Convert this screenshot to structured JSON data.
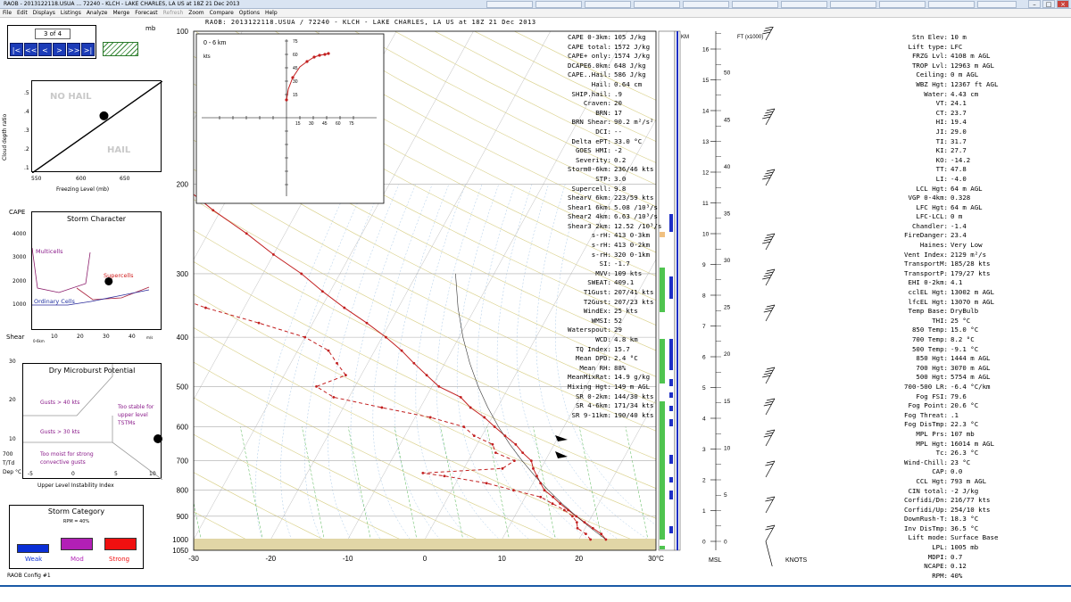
{
  "window": {
    "title": "RAOB - 2013122118.USUA ... 72240 - KLCH - LAKE CHARLES, LA US at 18Z 21 Dec 2013",
    "controls": [
      "–",
      "□",
      "×"
    ]
  },
  "menu": [
    {
      "label": "File",
      "enabled": true
    },
    {
      "label": "Edit",
      "enabled": true
    },
    {
      "label": "Displays",
      "enabled": true
    },
    {
      "label": "Listings",
      "enabled": true
    },
    {
      "label": "Analyze",
      "enabled": true
    },
    {
      "label": "Merge",
      "enabled": true
    },
    {
      "label": "Forecast",
      "enabled": true
    },
    {
      "label": "Refresh",
      "enabled": false
    },
    {
      "label": "Zoom",
      "enabled": true
    },
    {
      "label": "Compare",
      "enabled": true
    },
    {
      "label": "Options",
      "enabled": true
    },
    {
      "label": "Help",
      "enabled": true
    }
  ],
  "header": {
    "title": "RAOB:  2013122118.USUA / 72240 - KLCH - LAKE CHARLES, LA US at 18Z 21 Dec 2013"
  },
  "nav": {
    "count": "3 of 4",
    "unit": "mb",
    "buttons": [
      "|<",
      "<<",
      "<",
      ">",
      ">>",
      ">|"
    ]
  },
  "hail": {
    "no_hail": "NO HAIL",
    "hail": "HAIL",
    "ylabel": "Cloud depth ratio",
    "xlabel": "Freezing Level (mb)",
    "yticks": [
      ".5",
      ".4",
      ".3",
      ".2",
      ".1"
    ],
    "xticks": [
      "550",
      "600",
      "650"
    ],
    "point": {
      "freezing_level_mb": 615,
      "cloud_depth_ratio": 0.4
    }
  },
  "storm": {
    "title": "Storm Character",
    "ylabel": "CAPE",
    "yticks": [
      "4000",
      "3000",
      "2000",
      "1000"
    ],
    "xlabel": "Shear",
    "xsub": "0-6km",
    "xticks": [
      "10",
      "20",
      "30",
      "40"
    ],
    "xunit": "m/s",
    "multicells": "Multicells",
    "supercells": "Supercells",
    "ordinary": "Ordinary Cells",
    "point": {
      "shear_ms": 27,
      "cape": 1572
    }
  },
  "micro": {
    "title": "Dry Microburst Potential",
    "gusts40": "Gusts > 40 kts",
    "gusts30": "Gusts > 30 kts",
    "toostable": "Too stable for upper level TSTMs",
    "toomoist": "Too moist for strong convective gusts",
    "yticks": [
      "30",
      "20",
      "10"
    ],
    "xticks": [
      "-5",
      "0",
      "5",
      "10"
    ],
    "ylabel": "700 T/Td Dep °C",
    "xlabel": "Upper Level Instability Index"
  },
  "category": {
    "title": "Storm Category",
    "rpm": "RPM = 40%",
    "labels": [
      "Weak",
      "Mod",
      "Strong"
    ],
    "colors": [
      "#0a2fd6",
      "#b21fb6",
      "#f01010"
    ]
  },
  "config": "RAOB Config #1",
  "skewt": {
    "pressure_labels": [
      "100",
      "200",
      "300",
      "400",
      "500",
      "600",
      "700",
      "800",
      "900",
      "1000",
      "1050"
    ],
    "temp_labels": [
      "-30",
      "-20",
      "-10",
      "0",
      "10",
      "20",
      "30°C"
    ],
    "hodo": {
      "title": "0 - 6 km",
      "unit": "kts",
      "ticks": [
        "75",
        "60",
        "45",
        "30",
        "15"
      ],
      "xticks": [
        "15",
        "30",
        "45",
        "60",
        "75"
      ]
    },
    "km_label": "KM",
    "ft_label": "FT (x1000)",
    "msl_label": "MSL",
    "knots_label": "KNOTS",
    "km_ticks": [
      "16",
      "15",
      "14",
      "13",
      "12",
      "11",
      "10",
      "9",
      "8",
      "7",
      "6",
      "5",
      "4",
      "3",
      "2",
      "1",
      "0"
    ],
    "ft_ticks": [
      "50",
      "45",
      "40",
      "35",
      "30",
      "25",
      "20",
      "15",
      "10",
      "5",
      "0"
    ]
  },
  "mid_table": [
    {
      "label": "CAPE 0-3km:",
      "value": "105 J/kg"
    },
    {
      "label": "CAPE total:",
      "value": "1572 J/kg"
    },
    {
      "label": "CAPE+ only:",
      "value": "1574 J/kg"
    },
    {
      "label": "DCAPE6.0km:",
      "value": "648 J/kg"
    },
    {
      "label": "CAPE..Hail:",
      "value": "586 J/kg"
    },
    {
      "label": "Hail:",
      "value": "0.64 cm"
    },
    {
      "label": "SHIP.hail:",
      "value": ".9"
    },
    {
      "label": "Craven:",
      "value": "20"
    },
    {
      "label": "BRN:",
      "value": "17"
    },
    {
      "label": "BRN Shear:",
      "value": "90.2 m²/s²"
    },
    {
      "label": "DCI:",
      "value": "--"
    },
    {
      "label": "Delta ePT:",
      "value": "33.0 °C"
    },
    {
      "label": "GOES HMI:",
      "value": "-2"
    },
    {
      "label": "Severity:",
      "value": "0.2"
    },
    {
      "label": "Storm0-6km:",
      "value": "236/46 kts"
    },
    {
      "label": "STP:",
      "value": "3.0"
    },
    {
      "label": "Supercell:",
      "value": "9.8"
    },
    {
      "label": "ShearV 6km:",
      "value": "223/59 kts"
    },
    {
      "label": "Shear1 6km:",
      "value": "5.08 /10³/s"
    },
    {
      "label": "Shear2 4km:",
      "value": "6.63 /10³/s"
    },
    {
      "label": "Shear3 2km:",
      "value": "12.52 /10³/s"
    },
    {
      "label": "s-rH:",
      "value": "413  0-3km"
    },
    {
      "label": "s-rH:",
      "value": "413  0-2km"
    },
    {
      "label": "s-rH:",
      "value": "320  0-1km"
    },
    {
      "label": "SI:",
      "value": "-1.7"
    },
    {
      "label": "MVV:",
      "value": "109 kts"
    },
    {
      "label": "SWEAT:",
      "value": "409.1"
    },
    {
      "label": "T1Gust:",
      "value": "207/41 kts"
    },
    {
      "label": "T2Gust:",
      "value": "207/23 kts"
    },
    {
      "label": "WindEx:",
      "value": "25 kts"
    },
    {
      "label": "WMSI:",
      "value": "52"
    },
    {
      "label": "Waterspout:",
      "value": "29"
    },
    {
      "label": "WCD:",
      "value": "4.8 km"
    },
    {
      "label": "TQ Index:",
      "value": "15.7"
    },
    {
      "label": "Mean DPD:",
      "value": "2.4 °C"
    },
    {
      "label": "Mean RH:",
      "value": "88%"
    },
    {
      "label": "MeanMixRat:",
      "value": "14.9 g/kg"
    },
    {
      "label": "Mixing Hgt:",
      "value": "149 m AGL"
    },
    {
      "label": "SR 0-2km:",
      "value": "144/30 kts"
    },
    {
      "label": "SR 4-6km:",
      "value": "171/34 kts"
    },
    {
      "label": "SR 9-11km:",
      "value": "190/40 kts"
    }
  ],
  "right_table": [
    {
      "label": "Stn Elev:",
      "value": "10 m"
    },
    {
      "label": "Lift type:",
      "value": "LFC"
    },
    {
      "label": "FRZG Lvl:",
      "value": "4108 m AGL"
    },
    {
      "label": "TROP Lvl:",
      "value": "12963 m AGL"
    },
    {
      "label": "Ceiling:",
      "value": "0 m AGL"
    },
    {
      "label": "WBZ Hgt:",
      "value": "12367 ft AGL"
    },
    {
      "label": "Water:",
      "value": "4.43 cm"
    },
    {
      "label": "VT:",
      "value": "24.1"
    },
    {
      "label": "CT:",
      "value": "23.7"
    },
    {
      "label": "HI:",
      "value": "19.4"
    },
    {
      "label": "JI:",
      "value": "29.0"
    },
    {
      "label": "TI:",
      "value": "31.7"
    },
    {
      "label": "KI:",
      "value": "27.7"
    },
    {
      "label": "KO:",
      "value": "-14.2"
    },
    {
      "label": "TT:",
      "value": "47.8"
    },
    {
      "label": "LI:",
      "value": "-4.0"
    },
    {
      "label": "LCL Hgt:",
      "value": "64 m AGL"
    },
    {
      "label": "VGP 0-4km:",
      "value": "0.328"
    },
    {
      "label": "LFC Hgt:",
      "value": "64 m AGL"
    },
    {
      "label": "LFC-LCL:",
      "value": "0 m"
    },
    {
      "label": "Chandler:",
      "value": "-1.4"
    },
    {
      "label": "FireDanger:",
      "value": "23.4"
    },
    {
      "label": "Haines:",
      "value": "Very Low"
    },
    {
      "label": "Vent Index:",
      "value": "2129 m²/s"
    },
    {
      "label": "TransportM:",
      "value": "185/28 kts"
    },
    {
      "label": "TransportP:",
      "value": "179/27 kts"
    },
    {
      "label": "EHI 0-2km:",
      "value": "4.1"
    },
    {
      "label": "cclEL Hgt:",
      "value": "13002 m AGL"
    },
    {
      "label": "lfcEL Hgt:",
      "value": "13070 m AGL"
    },
    {
      "label": "Temp Base:",
      "value": "DryBulb"
    },
    {
      "label": "THI:",
      "value": "25 °C"
    },
    {
      "label": "850 Temp:",
      "value": "15.0 °C"
    },
    {
      "label": "700 Temp:",
      "value": "8.2 °C"
    },
    {
      "label": "500 Temp:",
      "value": "-9.1 °C"
    },
    {
      "label": "850 Hgt:",
      "value": "1444 m AGL"
    },
    {
      "label": "700 Hgt:",
      "value": "3070 m AGL"
    },
    {
      "label": "500 Hgt:",
      "value": "5754 m AGL"
    },
    {
      "label": "700-500 LR:",
      "value": "-6.4 °C/km"
    },
    {
      "label": "Fog FSI:",
      "value": "79.6"
    },
    {
      "label": "Fog Point:",
      "value": "20.6 °C"
    },
    {
      "label": "Fog Threat:",
      "value": ".1"
    },
    {
      "label": "Fog DisTmp:",
      "value": "22.3 °C"
    },
    {
      "label": "MPL Prs:",
      "value": "107 mb"
    },
    {
      "label": "MPL Hgt:",
      "value": "16014 m AGL"
    },
    {
      "label": "Tc:",
      "value": "26.3 °C"
    },
    {
      "label": "Wind-Chill:",
      "value": "23 °C"
    },
    {
      "label": "CAP:",
      "value": "0.0"
    },
    {
      "label": "CCL Hgt:",
      "value": "793 m AGL"
    },
    {
      "label": "CIN total:",
      "value": "-2 J/kg"
    },
    {
      "label": "Corfidi/Dn:",
      "value": "216/77 kts"
    },
    {
      "label": "Corfidi/Up:",
      "value": "254/10 kts"
    },
    {
      "label": "DownRush-T:",
      "value": "18.3 °C"
    },
    {
      "label": "Inv DisTmp:",
      "value": "36.5 °C"
    },
    {
      "label": "Lift mode:",
      "value": "Surface Base"
    },
    {
      "label": "LPL:",
      "value": "1005 mb"
    },
    {
      "label": "MDPI:",
      "value": "0.7"
    },
    {
      "label": "NCAPE:",
      "value": "0.12"
    },
    {
      "label": "RPM:",
      "value": "40%"
    }
  ]
}
